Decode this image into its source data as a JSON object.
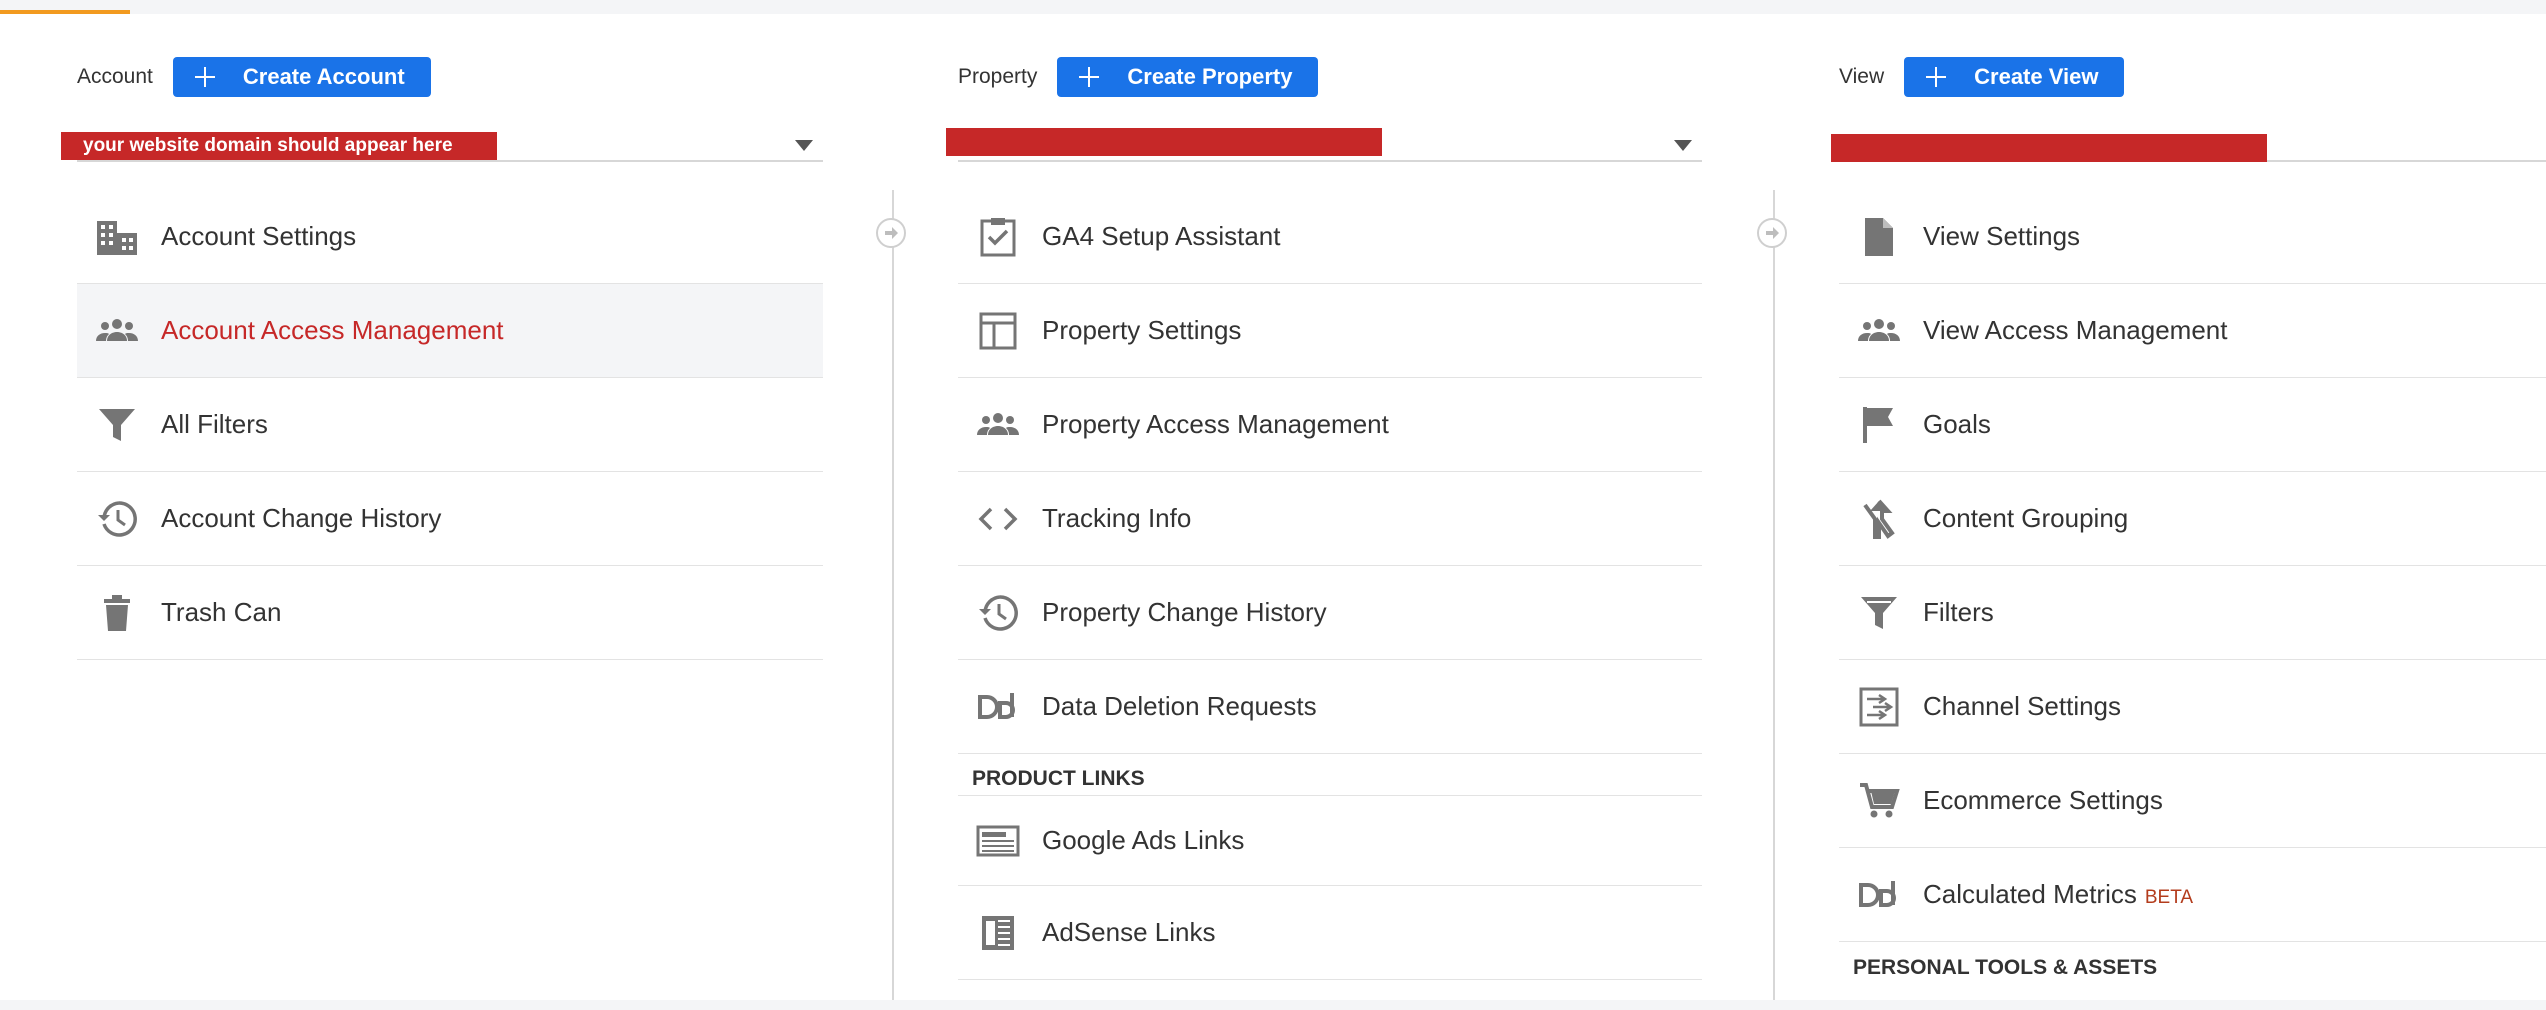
{
  "colors": {
    "accent": "#1a73e8",
    "redaction": "#c62828",
    "progress": "#f29a1f",
    "active_text": "#c62828",
    "icon": "#757575"
  },
  "account": {
    "label": "Account",
    "create_label": "Create Account",
    "selector_text": "your website domain should appear here",
    "items": [
      {
        "label": "Account Settings",
        "icon": "building-icon"
      },
      {
        "label": "Account Access Management",
        "icon": "people-icon",
        "active": true
      },
      {
        "label": "All Filters",
        "icon": "filter-icon"
      },
      {
        "label": "Account Change History",
        "icon": "history-icon"
      },
      {
        "label": "Trash Can",
        "icon": "trash-icon"
      }
    ]
  },
  "property": {
    "label": "Property",
    "create_label": "Create Property",
    "selector_text": "",
    "items": [
      {
        "label": "GA4 Setup Assistant",
        "icon": "clipboard-check-icon"
      },
      {
        "label": "Property Settings",
        "icon": "layout-icon"
      },
      {
        "label": "Property Access Management",
        "icon": "people-icon"
      },
      {
        "label": "Tracking Info",
        "icon": "code-icon"
      },
      {
        "label": "Property Change History",
        "icon": "history-icon"
      },
      {
        "label": "Data Deletion Requests",
        "icon": "dd-icon"
      }
    ],
    "section_title": "PRODUCT LINKS",
    "link_items": [
      {
        "label": "Google Ads Links",
        "icon": "ads-icon"
      },
      {
        "label": "AdSense Links",
        "icon": "adsense-icon"
      }
    ]
  },
  "view": {
    "label": "View",
    "create_label": "Create View",
    "selector_text": "",
    "items": [
      {
        "label": "View Settings",
        "icon": "document-icon"
      },
      {
        "label": "View Access Management",
        "icon": "people-icon"
      },
      {
        "label": "Goals",
        "icon": "flag-icon"
      },
      {
        "label": "Content Grouping",
        "icon": "merge-icon"
      },
      {
        "label": "Filters",
        "icon": "filter-icon"
      },
      {
        "label": "Channel Settings",
        "icon": "channel-icon"
      },
      {
        "label": "Ecommerce Settings",
        "icon": "cart-icon"
      },
      {
        "label": "Calculated Metrics",
        "icon": "dd-icon",
        "badge": "BETA"
      }
    ],
    "section_title": "PERSONAL TOOLS & ASSETS"
  }
}
